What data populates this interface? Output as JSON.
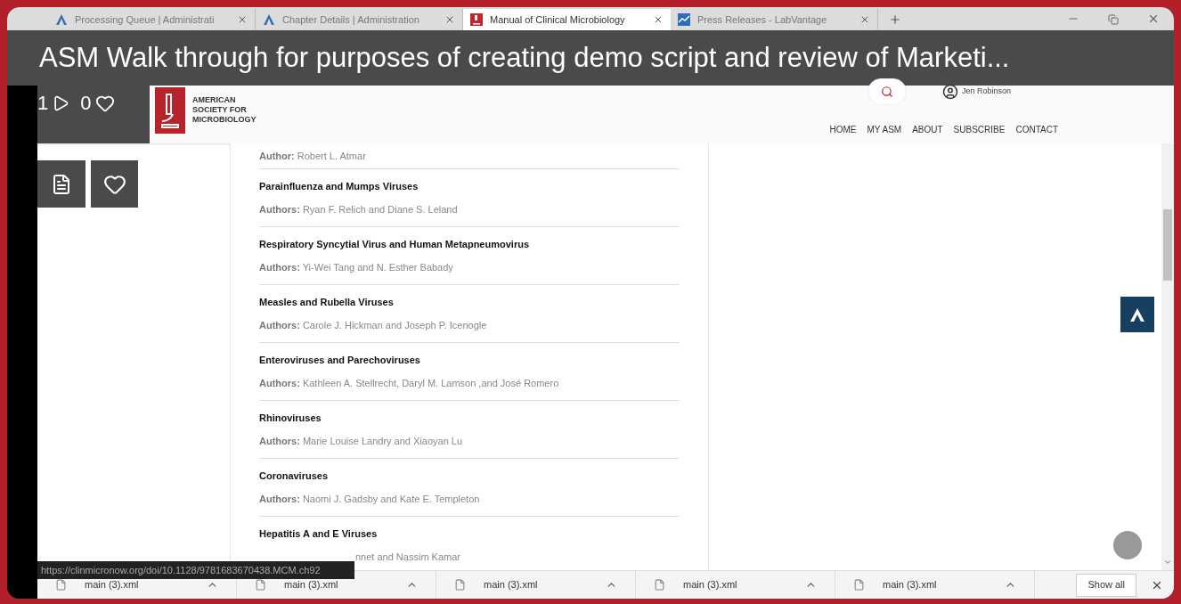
{
  "browser_tabs": [
    {
      "title": "Processing Queue | Administrati",
      "kind": "a-logo",
      "selected": false
    },
    {
      "title": "Chapter Details | Administration",
      "kind": "a-logo",
      "selected": false
    },
    {
      "title": "Manual of Clinical Microbiology",
      "kind": "asm-logo",
      "selected": true
    },
    {
      "title": "Press Releases - LabVantage",
      "kind": "chart-logo",
      "selected": false
    }
  ],
  "video": {
    "title": "ASM Walk through for purposes of creating demo script and review of Marketi...",
    "plays": "1",
    "likes": "0"
  },
  "site": {
    "logo_lines": [
      "AMERICAN",
      "SOCIETY FOR",
      "MICROBIOLOGY"
    ],
    "user": "Jen Robinson",
    "nav": [
      "HOME",
      "MY ASM",
      "ABOUT",
      "SUBSCRIBE",
      "CONTACT"
    ]
  },
  "chapters": [
    {
      "label": "Author:",
      "names": "Robert L. Atmar"
    },
    {
      "title": "Parainfluenza and Mumps Viruses",
      "label": "Authors:",
      "names": "Ryan F. Relich and Diane S. Leland"
    },
    {
      "title": "Respiratory Syncytial Virus and Human Metapneumovirus",
      "label": "Authors:",
      "names": "Yi-Wei Tang and N. Esther Babady"
    },
    {
      "title": "Measles and Rubella Viruses",
      "label": "Authors:",
      "names": "Carole J. Hickman and Joseph P. Icenogle"
    },
    {
      "title": "Enteroviruses and Parechoviruses",
      "label": "Authors:",
      "names": "Kathleen A. Stellrecht, Daryl M. Lamson ,and José Romero"
    },
    {
      "title": "Rhinoviruses",
      "label": "Authors:",
      "names": "Marie Louise Landry and Xiaoyan Lu"
    },
    {
      "title": "Coronaviruses",
      "label": "Authors:",
      "names": "Naomi J. Gadsby and Kate E. Templeton"
    },
    {
      "title": "Hepatitis A and E Viruses",
      "names": "nnet and Nassim Kamar"
    }
  ],
  "status_url": "https://clinmicronow.org/doi/10.1128/9781683670438.MCM.ch92",
  "downloads": [
    "main (3).xml",
    "main (3).xml",
    "main (3).xml",
    "main (3).xml",
    "main (3).xml"
  ],
  "show_all": "Show all"
}
